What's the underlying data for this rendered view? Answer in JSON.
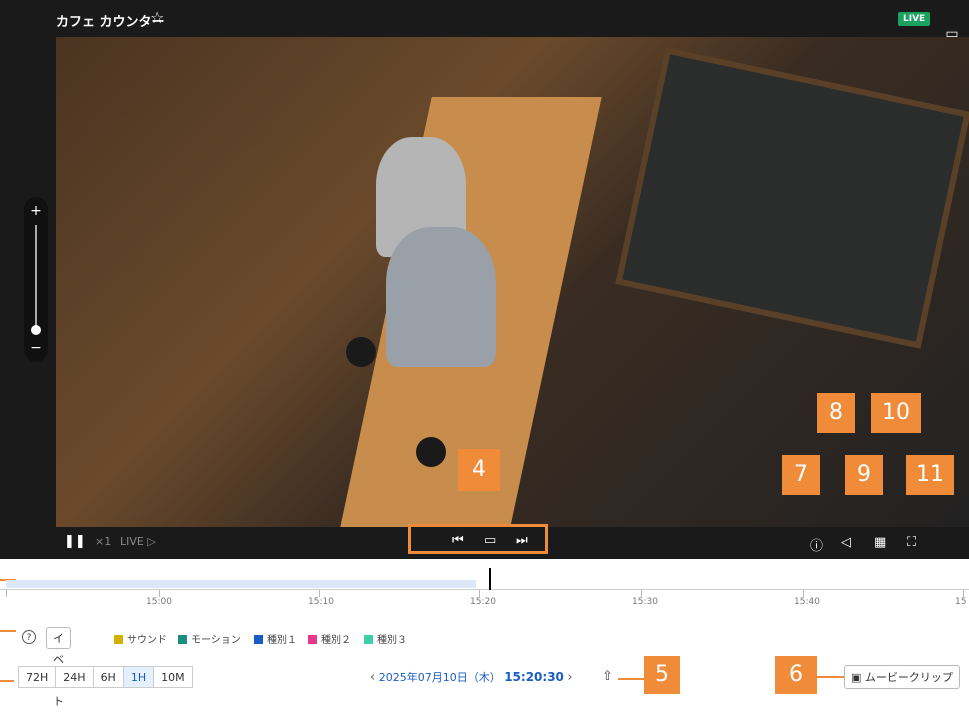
{
  "camera": {
    "title": "カフェ カウンター",
    "live_badge": "LIVE"
  },
  "player": {
    "speed": "×1",
    "live_label": "LIVE ▷"
  },
  "timeline": {
    "ticks": [
      "15:00",
      "15:10",
      "15:20",
      "15:30",
      "15:40",
      "15"
    ]
  },
  "legend": {
    "event_button": "イベント",
    "items": [
      {
        "label": "サウンド",
        "color": "#d4b100"
      },
      {
        "label": "モーション",
        "color": "#1a8f7f"
      },
      {
        "label": "種別１",
        "color": "#1a5cc6"
      },
      {
        "label": "種別２",
        "color": "#e8388e"
      },
      {
        "label": "種別３",
        "color": "#3ecfa6"
      }
    ]
  },
  "ranges": {
    "buttons": [
      "72H",
      "24H",
      "6H",
      "1H",
      "10M"
    ],
    "selected": "1H"
  },
  "date": {
    "date_text": "2025年07月10日（木）",
    "time_text": "15:20:30"
  },
  "clip": {
    "label": "ムービークリップ"
  },
  "callouts": [
    "4",
    "5",
    "6",
    "7",
    "8",
    "9",
    "10",
    "11"
  ],
  "colors": {
    "accent": "#f08b3a",
    "live": "#1aa260",
    "link": "#1a5cc6"
  }
}
